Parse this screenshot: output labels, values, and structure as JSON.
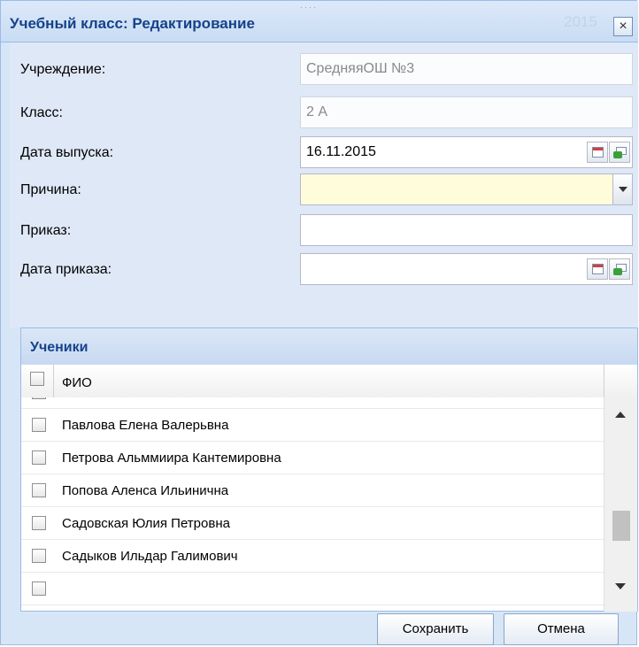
{
  "dialog": {
    "title": "Учебный класс: Редактирование",
    "ghost_text": "2015",
    "close_label": "×"
  },
  "form": {
    "institution": {
      "label": "Учреждение:",
      "value": "СредняяОШ №3"
    },
    "class": {
      "label": "Класс:",
      "value": "2 А"
    },
    "grad_date": {
      "label": "Дата выпуска:",
      "value": "16.11.2015"
    },
    "reason": {
      "label": "Причина:",
      "value": ""
    },
    "order": {
      "label": "Приказ:",
      "value": ""
    },
    "order_date": {
      "label": "Дата приказа:",
      "value": ""
    }
  },
  "students": {
    "title": "Ученики",
    "column_fio": "ФИО",
    "rows": [
      "Павлова Елена Валерьвна",
      "Петрова Альммиира Кантемировна",
      "Попова Аленса Ильинична",
      "Садовская Юлия Петровна",
      "Садыков Ильдар Галимович"
    ]
  },
  "buttons": {
    "save": "Сохранить",
    "cancel": "Отмена"
  },
  "colors": {
    "header_text": "#15428b",
    "required_bg": "#fffcdc",
    "panel_border": "#99bbe8"
  }
}
